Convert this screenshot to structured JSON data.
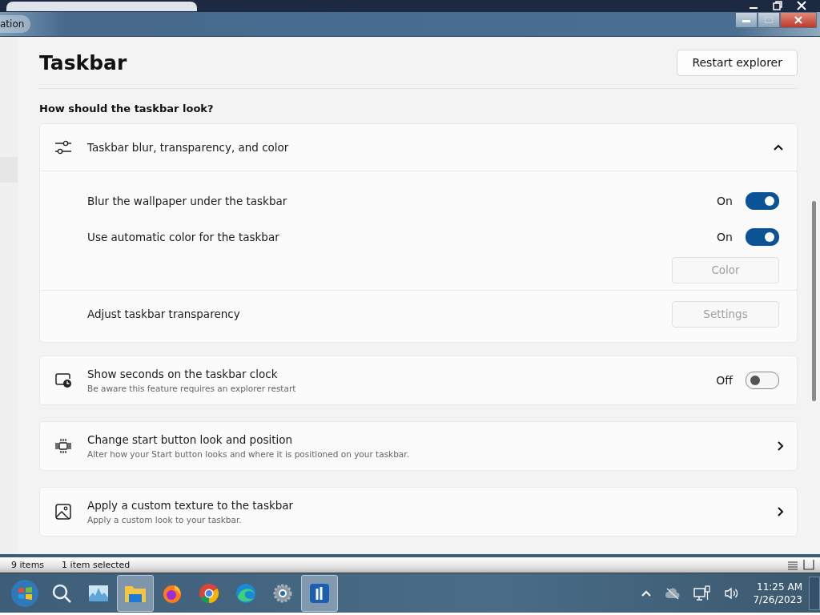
{
  "window": {
    "title": "ation"
  },
  "page": {
    "title": "Taskbar",
    "restart_button": "Restart explorer"
  },
  "section_heading": "How should the taskbar look?",
  "expander": {
    "title": "Taskbar blur, transparency, and color",
    "expanded": true,
    "rows": [
      {
        "kind": "toggle",
        "label": "Blur the wallpaper under the taskbar",
        "state_text": "On",
        "on": true
      },
      {
        "kind": "toggle",
        "label": "Use automatic color for the taskbar",
        "state_text": "On",
        "on": true
      },
      {
        "kind": "button",
        "button": "Color",
        "disabled": true
      },
      {
        "kind": "button",
        "label": "Adjust taskbar transparency",
        "button": "Settings",
        "disabled": true
      }
    ]
  },
  "cards": [
    {
      "kind": "toggle",
      "title": "Show seconds on the taskbar clock",
      "subtitle": "Be aware this feature requires an explorer restart",
      "state_text": "Off",
      "on": false
    },
    {
      "kind": "link",
      "title": "Change start button look and position",
      "subtitle": "Alter how your Start button looks and where it is positioned on your taskbar."
    },
    {
      "kind": "link",
      "title": "Apply a custom texture to the taskbar",
      "subtitle": "Apply a custom look to your taskbar."
    }
  ],
  "status_bar": {
    "item_count": "9 items",
    "selection": "1 item selected"
  },
  "taskbar": {
    "apps": [
      {
        "kind": "start",
        "active": false
      },
      {
        "kind": "search",
        "active": false
      },
      {
        "kind": "monitor",
        "active": false
      },
      {
        "kind": "folder",
        "active": true
      },
      {
        "kind": "firefox",
        "active": false
      },
      {
        "kind": "chrome",
        "active": false
      },
      {
        "kind": "edge",
        "active": false
      },
      {
        "kind": "gear",
        "active": false
      },
      {
        "kind": "app",
        "active": true
      }
    ],
    "time": "11:25 AM",
    "date": "7/26/2023"
  }
}
